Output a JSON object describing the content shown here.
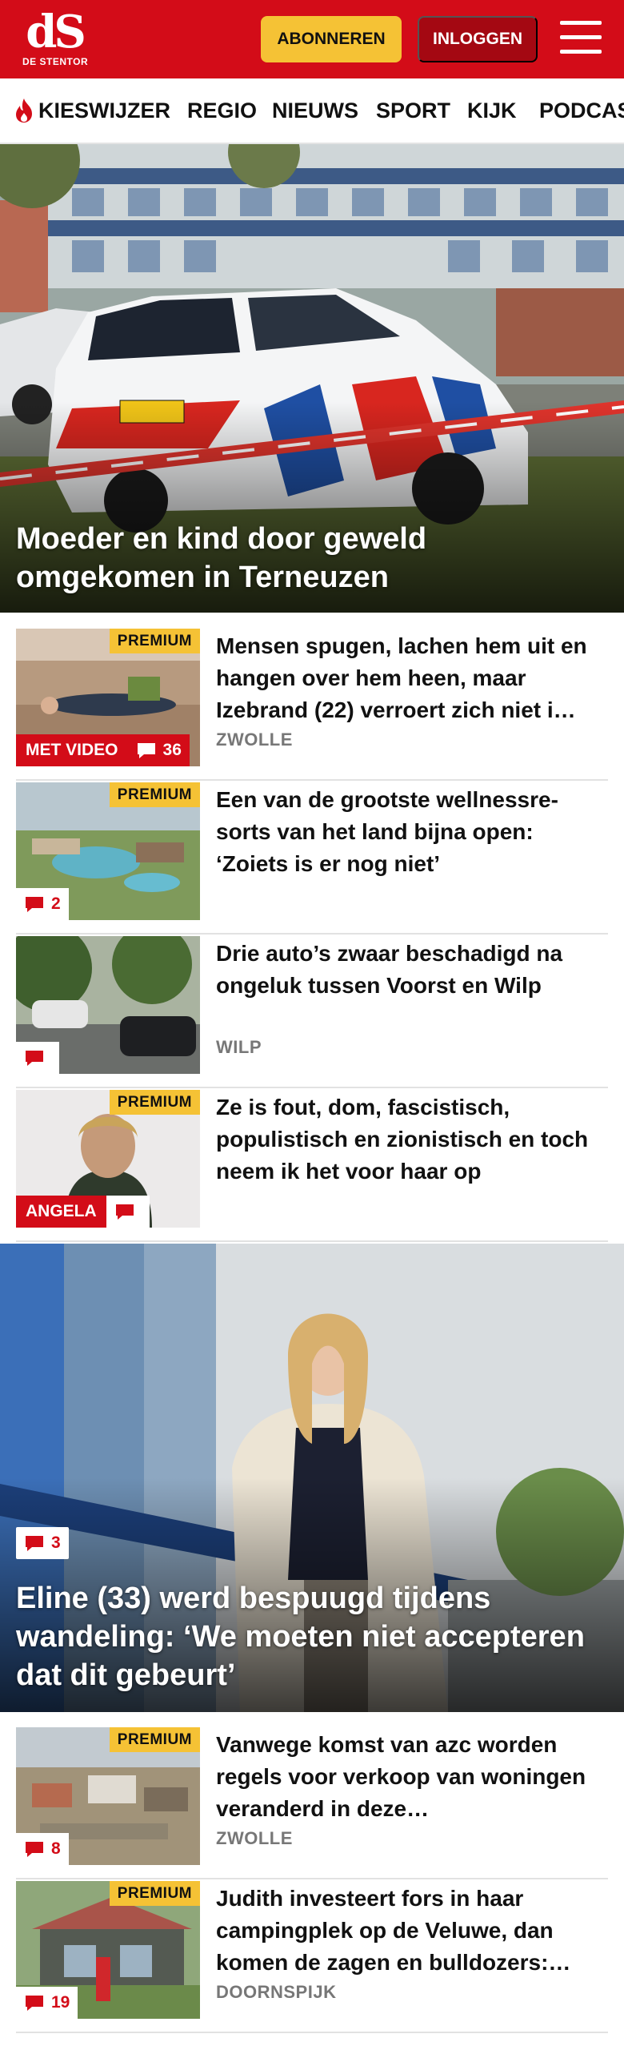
{
  "header": {
    "logo_text": "dS",
    "logo_sub": "DE STENTOR",
    "subscribe_label": "ABONNEREN",
    "login_label": "INLOGGEN",
    "brand_color": "#d30c18",
    "accent_color": "#f5c235"
  },
  "nav": {
    "items": [
      {
        "label": "KIESWIJZER",
        "icon": "flame-icon"
      },
      {
        "label": "REGIO"
      },
      {
        "label": "NIEUWS"
      },
      {
        "label": "SPORT"
      },
      {
        "label": "KIJK"
      },
      {
        "label": "PODCAS"
      }
    ]
  },
  "hero": {
    "title": "Moeder en kind door geweld omgekomen in Terneuzen"
  },
  "articles": [
    {
      "title": "Mensen spugen, lachen hem uit en hangen over hem heen, maar Izebrand (22) verroert zich niet i…",
      "location": "ZWOLLE",
      "premium": "PREMIUM",
      "label": "MET VIDEO",
      "comments": "36"
    },
    {
      "title": "Een van de grootste wellnessre­sorts van het land bijna open: ‘Zoiets is er nog niet’",
      "premium": "PREMIUM",
      "comments": "2"
    },
    {
      "title": "Drie auto’s zwaar beschadigd na ongeluk tussen Voorst en Wilp",
      "location": "WILP",
      "comments": ""
    },
    {
      "title": "Ze is fout, dom, fascistisch, populistisch en zionistisch en toch neem ik het voor haar op",
      "premium": "PREMIUM",
      "label": "ANGELA",
      "comments": ""
    }
  ],
  "big_story": {
    "title": "Eline (33) werd bespuugd tijdens wandeling: ‘We moeten niet accepteren dat dit gebeurt’",
    "comments": "3"
  },
  "articles2": [
    {
      "title": "Vanwege komst van azc worden regels voor verkoop van woningen veranderd in deze…",
      "location": "ZWOLLE",
      "premium": "PREMIUM",
      "comments": "8"
    },
    {
      "title": "Judith investeert fors in haar campingplek op de Veluwe, dan komen de zagen en bulldozers:…",
      "location": "DOORNSPIJK",
      "premium": "PREMIUM",
      "comments": "19"
    }
  ]
}
